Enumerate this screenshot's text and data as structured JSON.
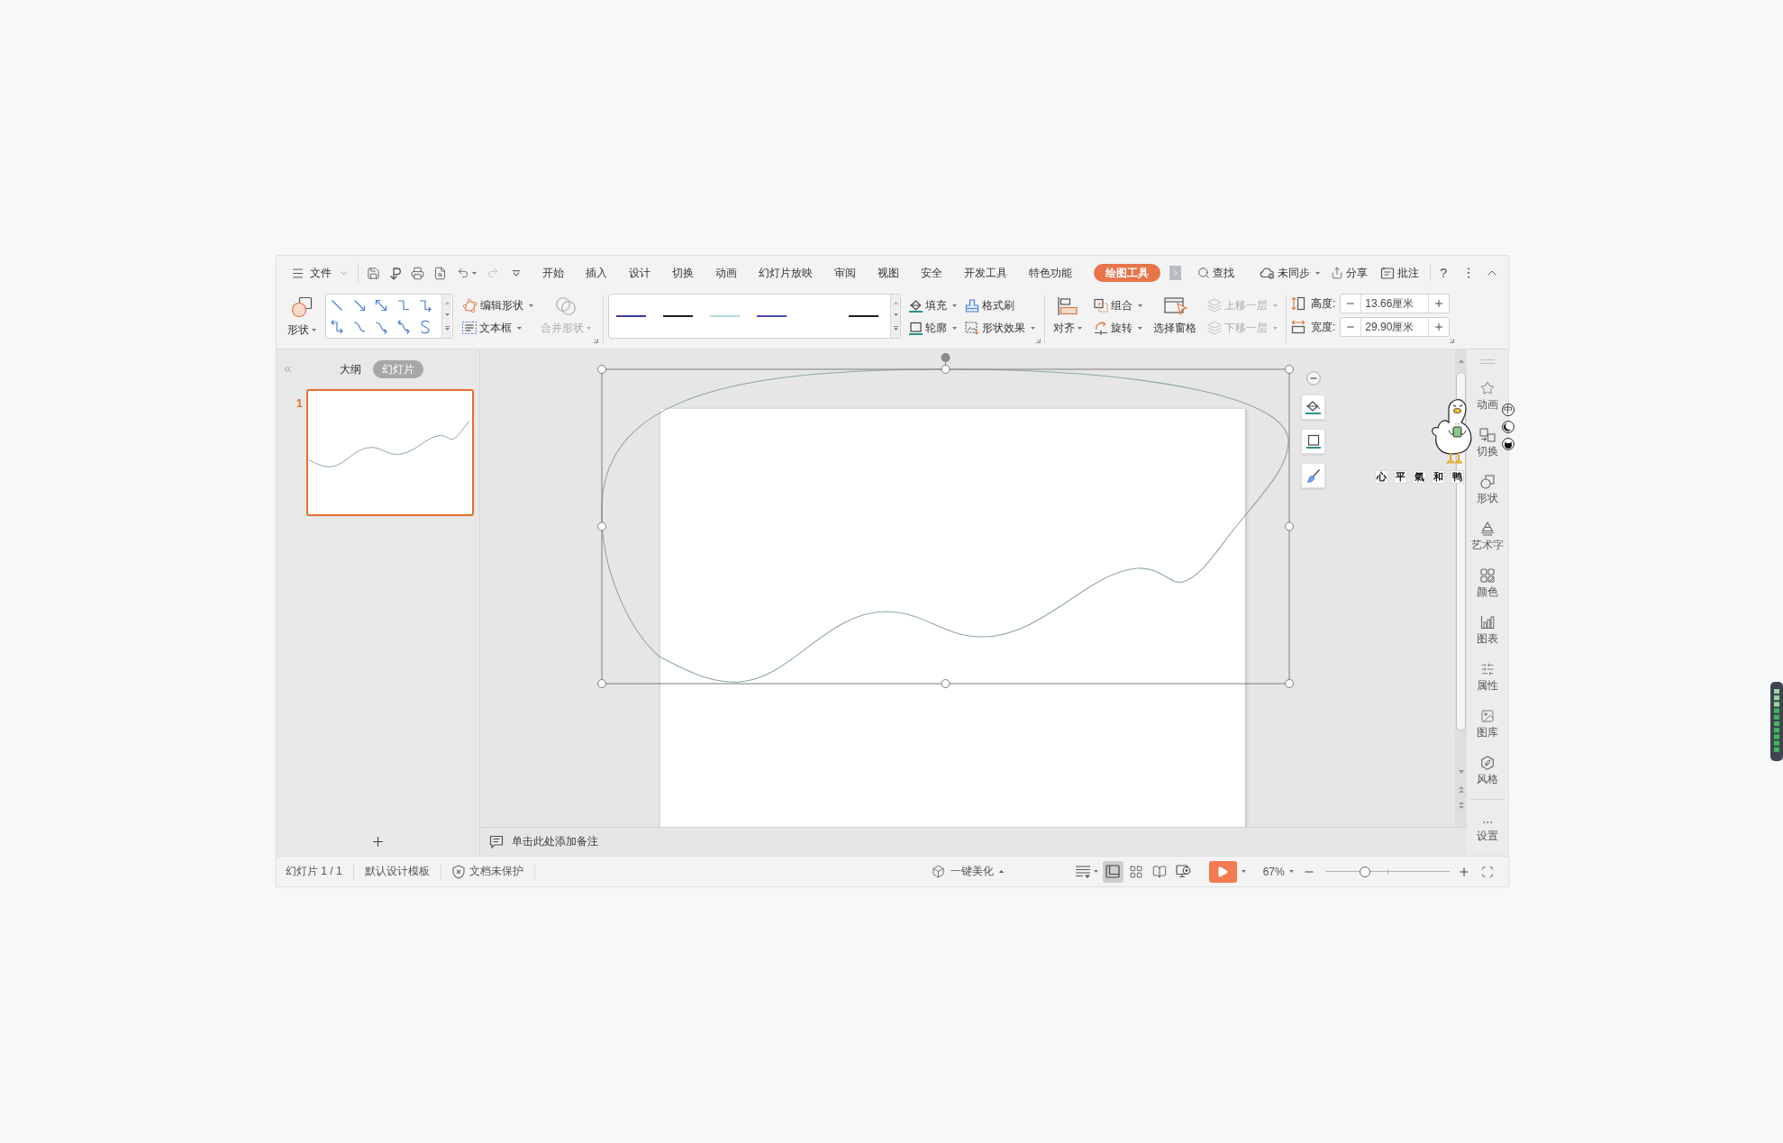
{
  "menu_bar": {
    "file": "文件",
    "tabs": [
      {
        "label": "开始",
        "selected": false
      },
      {
        "label": "插入",
        "selected": false
      },
      {
        "label": "设计",
        "selected": false
      },
      {
        "label": "切换",
        "selected": false
      },
      {
        "label": "动画",
        "selected": false
      },
      {
        "label": "幻灯片放映",
        "selected": false
      },
      {
        "label": "审阅",
        "selected": false
      },
      {
        "label": "视图",
        "selected": false
      },
      {
        "label": "安全",
        "selected": false
      },
      {
        "label": "开发工具",
        "selected": false
      },
      {
        "label": "特色功能",
        "selected": false
      },
      {
        "label": "绘图工具",
        "selected": true
      }
    ],
    "search": "查找",
    "sync": "未同步",
    "share": "分享",
    "comment": "批注",
    "help": "?"
  },
  "ribbon": {
    "shapes": "形状",
    "edit_shape": "编辑形状",
    "text_box": "文本框",
    "merge_shapes": {
      "label": "合并形状",
      "disabled": true
    },
    "line_styles": [
      {
        "color": "#3b3b9b"
      },
      {
        "color": "#1e1e1e"
      },
      {
        "color": "#b2dcdc"
      },
      {
        "color": "#4b4bab"
      },
      {
        "color": "#1e1e1e"
      }
    ],
    "fill": "填充",
    "outline": "轮廓",
    "format_painter": "格式刷",
    "shape_effects": "形状效果",
    "align": "对齐",
    "group": "组合",
    "rotate": "旋转",
    "selection_pane": "选择窗格",
    "bring_forward": {
      "label": "上移一层",
      "disabled": true
    },
    "send_backward": {
      "label": "下移一层",
      "disabled": true
    },
    "size": [
      {
        "label": "高度:",
        "value": "13.66厘米"
      },
      {
        "label": "宽度:",
        "value": "29.90厘米"
      }
    ]
  },
  "slides_panel": {
    "tabs": [
      {
        "label": "大纲",
        "selected": false
      },
      {
        "label": "幻灯片",
        "selected": true
      }
    ],
    "slides": [
      {
        "number": "1",
        "selected": true
      }
    ]
  },
  "canvas": {
    "shape": {
      "selected": true
    }
  },
  "notes": {
    "prompt": "单击此处添加备注"
  },
  "sidebar": {
    "items": [
      "动画",
      "切换",
      "形状",
      "艺术字",
      "颜色",
      "图表",
      "属性",
      "图库",
      "风格"
    ],
    "settings": "设置"
  },
  "status_bar": {
    "slide_counter": "幻灯片 1 / 1",
    "template": "默认设计模板",
    "protection": "文档未保护",
    "beautify": "一键美化",
    "views": [
      {
        "selected": true
      },
      {
        "selected": false
      },
      {
        "selected": false
      },
      {
        "selected": false
      }
    ],
    "zoom": "67%",
    "zoom_slider": {
      "level": 0.32
    }
  },
  "overlay": {
    "ime_mode": "中",
    "sticker_caption": [
      "心",
      "平",
      "氣",
      "和",
      "鸭"
    ]
  }
}
